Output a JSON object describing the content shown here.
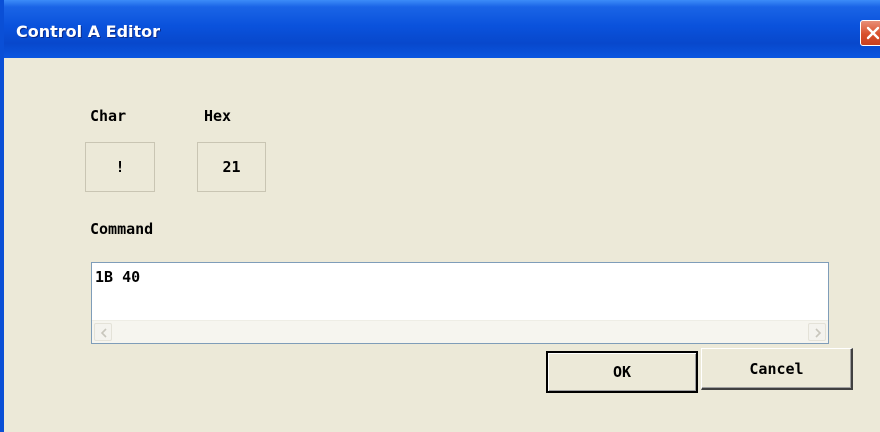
{
  "window": {
    "title": "Control A Editor"
  },
  "fields": {
    "char_label": "Char",
    "char_value": "!",
    "hex_label": "Hex",
    "hex_value": "21",
    "command_label": "Command",
    "command_value": "1B 40"
  },
  "buttons": {
    "ok_label": "OK",
    "cancel_label": "Cancel"
  },
  "icons": {
    "close": "close-icon",
    "scroll_left": "chevron-left-icon",
    "scroll_right": "chevron-right-icon"
  },
  "colors": {
    "titlebar": "#0a52dc",
    "close_button": "#d9512d",
    "dialog_background": "#ece9d8"
  }
}
